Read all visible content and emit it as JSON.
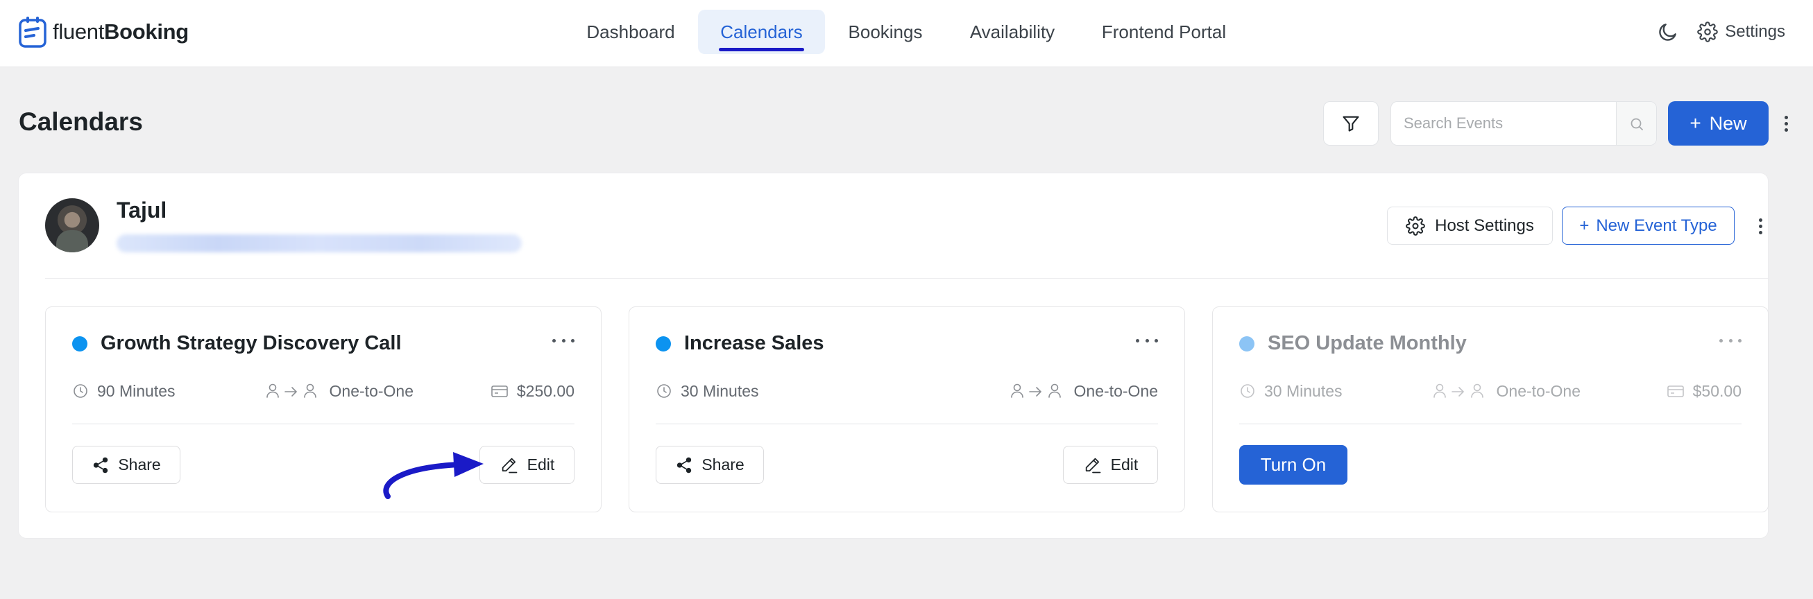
{
  "brand": {
    "name_light": "fluent",
    "name_bold": "Booking",
    "logo_icon": "fluentbooking-logo-icon"
  },
  "nav": {
    "items": [
      {
        "label": "Dashboard",
        "active": false
      },
      {
        "label": "Calendars",
        "active": true
      },
      {
        "label": "Bookings",
        "active": false
      },
      {
        "label": "Availability",
        "active": false
      },
      {
        "label": "Frontend Portal",
        "active": false
      }
    ],
    "dark_mode_icon": "moon-icon",
    "settings_label": "Settings",
    "settings_icon": "gear-icon"
  },
  "page": {
    "title": "Calendars",
    "search_placeholder": "Search Events",
    "new_label": "New",
    "filter_icon": "filter-icon",
    "search_icon": "search-icon"
  },
  "host": {
    "name": "Tajul",
    "host_settings_label": "Host Settings",
    "new_event_type_label": "New Event Type"
  },
  "events": [
    {
      "title": "Growth Strategy Discovery Call",
      "duration": "90 Minutes",
      "type": "One-to-One",
      "price": "$250.00",
      "share_label": "Share",
      "edit_label": "Edit",
      "status_color": "#0c93f0",
      "enabled": true
    },
    {
      "title": "Increase Sales",
      "duration": "30 Minutes",
      "type": "One-to-One",
      "share_label": "Share",
      "edit_label": "Edit",
      "status_color": "#0c93f0",
      "enabled": true
    },
    {
      "title": "SEO Update Monthly",
      "duration": "30 Minutes",
      "type": "One-to-One",
      "price": "$50.00",
      "turn_on_label": "Turn On",
      "status_color": "#8cc4f5",
      "enabled": false
    }
  ],
  "colors": {
    "primary": "#2563d6",
    "annotation_arrow": "#1a1ac7",
    "page_background": "#f0f0f1"
  }
}
